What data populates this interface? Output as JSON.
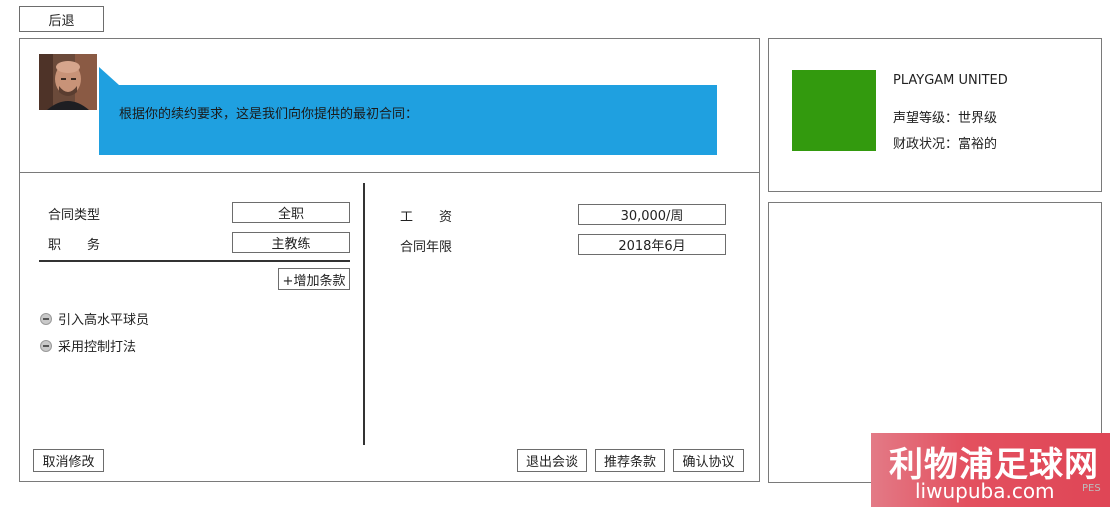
{
  "nav": {
    "back_label": "后退"
  },
  "message": {
    "text": "根据你的续约要求，这是我们向你提供的最初合同："
  },
  "club": {
    "name": "PLAYGAM UNITED",
    "reputation": "声望等级：世界级",
    "finance": "财政状况：富裕的",
    "color": "#339a0e"
  },
  "contract": {
    "type_label": "合同类型",
    "type_value": "全职",
    "role_label": "职　　务",
    "role_value": "主教练",
    "salary_label": "工　　资",
    "salary_value": "30,000/周",
    "term_label": "合同年限",
    "term_value": "2018年6月",
    "add_clause_label": "+增加条款",
    "clauses": [
      {
        "label": "引入高水平球员",
        "icon": "minus-circle-icon"
      },
      {
        "label": "采用控制打法",
        "icon": "minus-circle-icon"
      }
    ]
  },
  "actions": {
    "cancel_label": "取消修改",
    "exit_label": "退出会谈",
    "recommend_label": "推荐条款",
    "confirm_label": "确认协议"
  },
  "watermark": {
    "title": "利物浦足球网",
    "url": "liwupuba.com",
    "side_text": "PES"
  },
  "colors": {
    "bubble": "#1fa0e0",
    "border": "#7a7a7a"
  }
}
